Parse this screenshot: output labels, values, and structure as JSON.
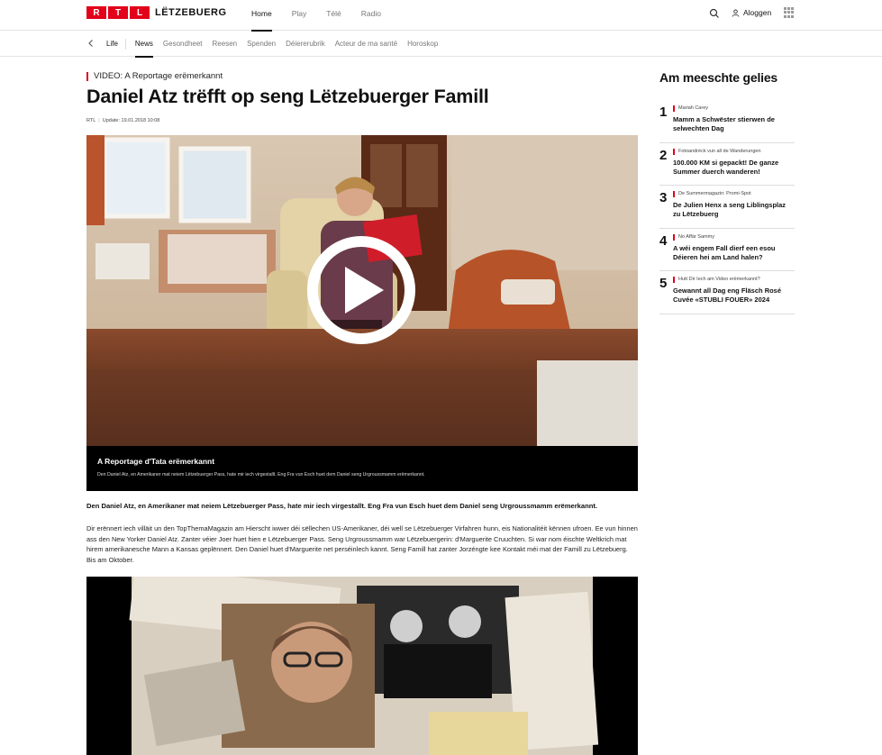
{
  "header": {
    "logo_letters": [
      "R",
      "T",
      "L"
    ],
    "logo_word": "LËTZEBUERG",
    "nav": [
      {
        "label": "Home",
        "active": true
      },
      {
        "label": "Play",
        "active": false
      },
      {
        "label": "Télé",
        "active": false
      },
      {
        "label": "Radio",
        "active": false
      }
    ],
    "login_label": "Aloggen",
    "icons": [
      "search-icon",
      "user-icon",
      "apps-grid-icon"
    ]
  },
  "subnav": {
    "items": [
      "Life",
      "News",
      "Gesondheet",
      "Reesen",
      "Spenden",
      "Déiererubrik",
      "Acteur de ma santé",
      "Horoskop"
    ],
    "active": "News"
  },
  "article": {
    "kicker": "VIDEO: A Reportage erëmerkannt",
    "title": "Daniel Atz trëfft op seng Lëtzebuerger Famill",
    "source": "RTL",
    "updated": "Update: 19.01.2018 10:08",
    "video_caption_title": "A Reportage d'Tata erëmerkannt",
    "video_caption_text": "Den Daniel Atz, en Amerikaner mat neiem Lëtzebuerger Pass, hate mir iech virgestallt. Eng Fra vun Esch huet dem Daniel seng Urgroussmamm erëmerkannt.",
    "lead": "Den Daniel Atz, en Amerikaner mat neiem Lëtzebuerger Pass, hate mir iech virgestallt. Eng Fra vun Esch huet dem Daniel seng Urgroussmamm erëmerkannt.",
    "body": "Dir erënnert iech villäit un den TopThemaMagazin am Hierscht iwwer déi sëllechen US-Amerikaner, déi well se Lëtzebuerger Virfahren hunn, eis Nationalitéit kënnen ufroen. Ee vun hinnen ass den New Yorker Daniel Atz. Zanter véier Joer huet hien e Lëtzebuerger Pass. Seng Urgroussmamm war Lëtzebuergerin: d'Marguerite Cruuchten. Si war nom éischte Weltkrich mat hirem amerikanesche Mann a Kansas geplënnert. Den Daniel huet d'Marguerite net perséinlech kannt. Seng Famill hat zanter Jorzéngte kee Kontakt méi mat der Famill zu Lëtzebuerg. Bis am Oktober."
  },
  "sidebar": {
    "title": "Am meeschte gelies",
    "items": [
      {
        "num": "1",
        "category": "Mariah Carey",
        "headline": "Mamm a Schwëster stierwen de selwechten Dag"
      },
      {
        "num": "2",
        "category": "Fotoandréck vun all de Wanderungen",
        "headline": "100.000 KM si gepackt! De ganze Summer duerch wanderen!"
      },
      {
        "num": "3",
        "category": "De Summermagazin: Promi-Spot",
        "headline": "De Julien Henx a seng Liblingsplaz zu Lëtzebuerg"
      },
      {
        "num": "4",
        "category": "No Affär Sammy",
        "headline": "A wéi engem Fall dierf een esou Déieren hei am Land halen?"
      },
      {
        "num": "5",
        "category": "Hutt Dir Iech am Video erëmerkannt?",
        "headline": "Gewannt all Dag eng Fläsch Rosé Cuvée «STUBLI FOUER» 2024"
      }
    ]
  },
  "colors": {
    "brand_red": "#e2001a",
    "text": "#111111"
  }
}
